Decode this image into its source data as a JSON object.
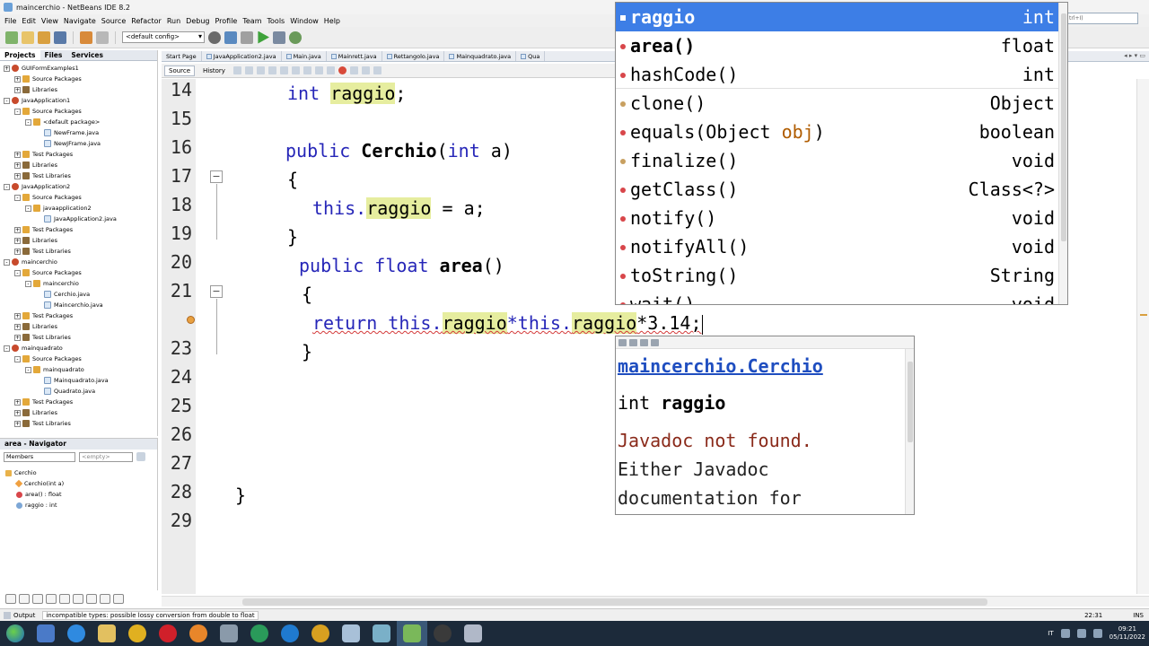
{
  "window": {
    "title": "maincerchio - NetBeans IDE 8.2"
  },
  "menu": [
    "File",
    "Edit",
    "View",
    "Navigate",
    "Source",
    "Refactor",
    "Run",
    "Debug",
    "Profile",
    "Team",
    "Tools",
    "Window",
    "Help"
  ],
  "toolbar": {
    "config": "<default config>"
  },
  "search": {
    "placeholder": "trl+I)"
  },
  "panel_tabs": [
    "Projects",
    "Files",
    "Services"
  ],
  "project_tree": [
    {
      "label": "GUIFormExamples1",
      "kind": "proj",
      "indent": 0,
      "exp": "+"
    },
    {
      "label": "Source Packages",
      "kind": "pkg",
      "indent": 1,
      "exp": "+"
    },
    {
      "label": "Libraries",
      "kind": "lib",
      "indent": 1,
      "exp": "+"
    },
    {
      "label": "JavaApplication1",
      "kind": "proj",
      "indent": 0,
      "exp": "-"
    },
    {
      "label": "Source Packages",
      "kind": "pkg",
      "indent": 1,
      "exp": "-"
    },
    {
      "label": "<default package>",
      "kind": "pkg",
      "indent": 2,
      "exp": "-"
    },
    {
      "label": "NewFrame.java",
      "kind": "file",
      "indent": 3,
      "exp": ""
    },
    {
      "label": "NewJFrame.java",
      "kind": "file",
      "indent": 3,
      "exp": ""
    },
    {
      "label": "Test Packages",
      "kind": "pkg",
      "indent": 1,
      "exp": "+"
    },
    {
      "label": "Libraries",
      "kind": "lib",
      "indent": 1,
      "exp": "+"
    },
    {
      "label": "Test Libraries",
      "kind": "lib",
      "indent": 1,
      "exp": "+"
    },
    {
      "label": "JavaApplication2",
      "kind": "proj",
      "indent": 0,
      "exp": "-"
    },
    {
      "label": "Source Packages",
      "kind": "pkg",
      "indent": 1,
      "exp": "-"
    },
    {
      "label": "javaapplication2",
      "kind": "pkg",
      "indent": 2,
      "exp": "-"
    },
    {
      "label": "JavaApplication2.java",
      "kind": "file",
      "indent": 3,
      "exp": ""
    },
    {
      "label": "Test Packages",
      "kind": "pkg",
      "indent": 1,
      "exp": "+"
    },
    {
      "label": "Libraries",
      "kind": "lib",
      "indent": 1,
      "exp": "+"
    },
    {
      "label": "Test Libraries",
      "kind": "lib",
      "indent": 1,
      "exp": "+"
    },
    {
      "label": "maincerchio",
      "kind": "proj",
      "indent": 0,
      "exp": "-"
    },
    {
      "label": "Source Packages",
      "kind": "pkg",
      "indent": 1,
      "exp": "-"
    },
    {
      "label": "maincerchio",
      "kind": "pkg",
      "indent": 2,
      "exp": "-"
    },
    {
      "label": "Cerchio.java",
      "kind": "file",
      "indent": 3,
      "exp": ""
    },
    {
      "label": "Maincerchio.java",
      "kind": "file",
      "indent": 3,
      "exp": ""
    },
    {
      "label": "Test Packages",
      "kind": "pkg",
      "indent": 1,
      "exp": "+"
    },
    {
      "label": "Libraries",
      "kind": "lib",
      "indent": 1,
      "exp": "+"
    },
    {
      "label": "Test Libraries",
      "kind": "lib",
      "indent": 1,
      "exp": "+"
    },
    {
      "label": "mainquadrato",
      "kind": "proj",
      "indent": 0,
      "exp": "-"
    },
    {
      "label": "Source Packages",
      "kind": "pkg",
      "indent": 1,
      "exp": "-"
    },
    {
      "label": "mainquadrato",
      "kind": "pkg",
      "indent": 2,
      "exp": "-"
    },
    {
      "label": "Mainquadrato.java",
      "kind": "file",
      "indent": 3,
      "exp": ""
    },
    {
      "label": "Quadrato.java",
      "kind": "file",
      "indent": 3,
      "exp": ""
    },
    {
      "label": "Test Packages",
      "kind": "pkg",
      "indent": 1,
      "exp": "+"
    },
    {
      "label": "Libraries",
      "kind": "lib",
      "indent": 1,
      "exp": "+"
    },
    {
      "label": "Test Libraries",
      "kind": "lib",
      "indent": 1,
      "exp": "+"
    }
  ],
  "navigator": {
    "title": "area - Navigator",
    "filter": "Members",
    "filter2": "<empty>",
    "items": [
      {
        "label": "Cerchio",
        "kind": "class",
        "indent": 0
      },
      {
        "label": "Cerchio(int a)",
        "kind": "ctor",
        "indent": 1
      },
      {
        "label": "area() : float",
        "kind": "method",
        "indent": 1
      },
      {
        "label": "raggio : int",
        "kind": "field",
        "indent": 1
      }
    ]
  },
  "editor_tabs": [
    "Start Page",
    "JavaApplication2.java",
    "Main.java",
    "Mainrett.java",
    "Rettangolo.java",
    "Mainquadrato.java",
    "Qua"
  ],
  "editor_subtabs": [
    "Source",
    "History"
  ],
  "code": {
    "line_numbers": [
      "14",
      "15",
      "16",
      "17",
      "18",
      "19",
      "20",
      "21",
      "22",
      "23",
      "24",
      "25",
      "26",
      "27",
      "28",
      "29"
    ],
    "l14_kw": "int ",
    "l14_field": "raggio",
    "l14_end": ";",
    "l16_kw": "public ",
    "l16_class": "Cerchio",
    "l16_paren": "(",
    "l16_int": "int",
    "l16_rest": " a)",
    "l17": "{",
    "l18_this": "this.",
    "l18_field": "raggio",
    "l18_rest": " = a;",
    "l19": "}",
    "l20_kw": "public float ",
    "l20_name": "area",
    "l20_rest": "()",
    "l21": "{",
    "l22_kw": "return this.",
    "l22_f1": "raggio",
    "l22_mid": "*this.",
    "l22_f2": "raggio",
    "l22_end": "*3.14;",
    "l23": "}",
    "l28": "}"
  },
  "completion": {
    "items": [
      {
        "name": "raggio",
        "type": "int"
      },
      {
        "name": "area()",
        "type": "float"
      },
      {
        "name": "hashCode()",
        "type": "int"
      },
      {
        "name": "clone()",
        "type": "Object"
      },
      {
        "name_a": "equals(Object ",
        "name_b": "obj",
        "name_c": ")",
        "type": "boolean"
      },
      {
        "name": "finalize()",
        "type": "void"
      },
      {
        "name": "getClass()",
        "type": "Class<?>"
      },
      {
        "name": "notify()",
        "type": "void"
      },
      {
        "name": "notifyAll()",
        "type": "void"
      },
      {
        "name": "toString()",
        "type": "String"
      },
      {
        "name": "wait()",
        "type": "void"
      }
    ]
  },
  "javadoc": {
    "link": "maincerchio.Cerchio",
    "sig_type": "int ",
    "sig_name": "raggio",
    "msg1": "Javadoc not found.",
    "msg2": "Either Javadoc",
    "msg3": "documentation for"
  },
  "status": {
    "output": "Output",
    "message": "incompatible types: possible lossy conversion from double to float",
    "position": "22:31",
    "mode": "INS"
  },
  "taskbar": {
    "lang": "IT",
    "time": "09:21",
    "date": "05/11/2022"
  },
  "colors": {
    "keyword": "#2626b8",
    "highlight": "#e6ed9f",
    "selection": "#3d7ee6",
    "current_line": "#eaf2fc"
  }
}
